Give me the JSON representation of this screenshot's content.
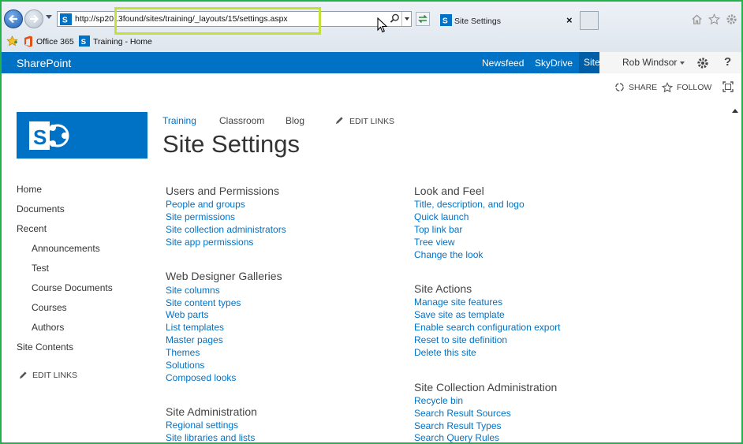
{
  "browser": {
    "url": "http://sp2013found/sites/training/_layouts/15/settings.aspx",
    "tab_title": "Site Settings",
    "tab_close": "×",
    "favorites": [
      "Office 365",
      "Training - Home"
    ]
  },
  "suitebar": {
    "brand": "SharePoint",
    "links": [
      "Newsfeed",
      "SkyDrive",
      "Sites"
    ],
    "active": "Sites",
    "user": "Rob Windsor",
    "help": "?"
  },
  "actions": {
    "share": "SHARE",
    "follow": "FOLLOW"
  },
  "topnav": {
    "items": [
      "Training",
      "Classroom",
      "Blog"
    ],
    "edit_links": "EDIT LINKS"
  },
  "page_title": "Site Settings",
  "leftnav": {
    "items": [
      "Home",
      "Documents",
      "Recent"
    ],
    "recent": [
      "Announcements",
      "Test",
      "Course Documents",
      "Courses",
      "Authors"
    ],
    "site_contents": "Site Contents",
    "edit_links": "EDIT LINKS"
  },
  "sections": {
    "users": {
      "title": "Users and Permissions",
      "links": [
        "People and groups",
        "Site permissions",
        "Site collection administrators",
        "Site app permissions"
      ]
    },
    "galleries": {
      "title": "Web Designer Galleries",
      "links": [
        "Site columns",
        "Site content types",
        "Web parts",
        "List templates",
        "Master pages",
        "Themes",
        "Solutions",
        "Composed looks"
      ]
    },
    "admin": {
      "title": "Site Administration",
      "links": [
        "Regional settings",
        "Site libraries and lists"
      ]
    },
    "look": {
      "title": "Look and Feel",
      "links": [
        "Title, description, and logo",
        "Quick launch",
        "Top link bar",
        "Tree view",
        "Change the look"
      ]
    },
    "site_actions": {
      "title": "Site Actions",
      "links": [
        "Manage site features",
        "Save site as template",
        "Enable search configuration export",
        "Reset to site definition",
        "Delete this site"
      ]
    },
    "collection": {
      "title": "Site Collection Administration",
      "links": [
        "Recycle bin",
        "Search Result Sources",
        "Search Result Types",
        "Search Query Rules"
      ]
    }
  },
  "colors": {
    "suitebar": "#0072c6",
    "link": "#0072c6",
    "highlight": "#c5e03a",
    "frame": "#22b14c"
  }
}
